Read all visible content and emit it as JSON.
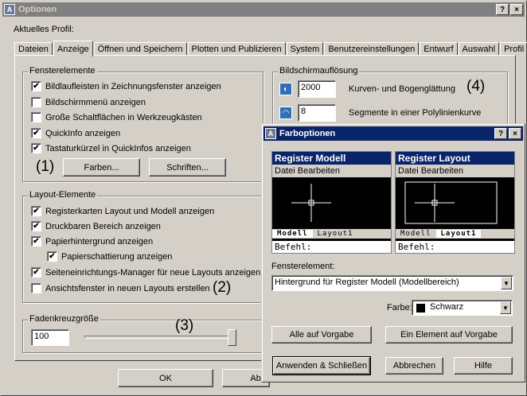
{
  "main_window": {
    "title": "Optionen",
    "help_btn": "?",
    "close_btn": "×",
    "profile_label": "Aktuelles Profil:",
    "tabs": [
      {
        "label": "Dateien"
      },
      {
        "label": "Anzeige"
      },
      {
        "label": "Öffnen und Speichern"
      },
      {
        "label": "Plotten und Publizieren"
      },
      {
        "label": "System"
      },
      {
        "label": "Benutzereinstellungen"
      },
      {
        "label": "Entwurf"
      },
      {
        "label": "Auswahl"
      },
      {
        "label": "Profil"
      }
    ],
    "selected_tab": "Anzeige"
  },
  "window_elements": {
    "legend": "Fensterelemente",
    "options": [
      {
        "label": "Bildlaufleisten in Zeichnungsfenster anzeigen",
        "checked": true
      },
      {
        "label": "Bildschirmmenü anzeigen",
        "checked": false
      },
      {
        "label": "Große Schaltflächen in Werkzeugkästen",
        "checked": false
      },
      {
        "label": "QuickInfo anzeigen",
        "checked": true
      },
      {
        "label": "Tastaturkürzel in QuickInfos anzeigen",
        "checked": true
      }
    ],
    "colors_button": "Farben...",
    "fonts_button": "Schriften...",
    "annotation": "(1)"
  },
  "layout_elements": {
    "legend": "Layout-Elemente",
    "options": [
      {
        "label": "Registerkarten Layout und Modell anzeigen",
        "checked": true
      },
      {
        "label": "Druckbaren Bereich anzeigen",
        "checked": true
      },
      {
        "label": "Papierhintergrund anzeigen",
        "checked": true
      },
      {
        "label": "Papierschattierung anzeigen",
        "checked": true
      },
      {
        "label": "Seiteneinrichtungs-Manager für neue Layouts anzeigen",
        "checked": true
      },
      {
        "label": "Ansichtsfenster in neuen Layouts erstellen",
        "checked": false
      }
    ],
    "annotation": "(2)"
  },
  "crosshair": {
    "legend": "Fadenkreuzgröße",
    "value": "100",
    "slider_level": 1.0,
    "annotation": "(3)"
  },
  "resolution": {
    "legend": "Bildschirmauflösung",
    "arc_value": "2000",
    "arc_label": "Kurven- und Bogenglättung",
    "seg_value": "8",
    "seg_label": "Segmente in einer Polylinienkurve",
    "annotation": "(4)"
  },
  "main_buttons": {
    "ok": "OK",
    "cancel_partial": "Abb"
  },
  "color_dialog": {
    "title": "Farboptionen",
    "help_btn": "?",
    "close_btn": "×",
    "preview_model": {
      "title": "Register Modell",
      "menu": "Datei  Bearbeiten",
      "tab_model": "Modell",
      "tab_layout": "Layout1",
      "command": "Befehl:"
    },
    "preview_layout": {
      "title": "Register Layout",
      "menu": "Datei  Bearbeiten",
      "tab_model": "Modell",
      "tab_layout": "Layout1",
      "command": "Befehl:"
    },
    "element_label": "Fensterelement:",
    "element_value": "Hintergrund für Register Modell (Modellbereich)",
    "color_label": "Farbe:",
    "color_value": "Schwarz",
    "color_swatch": "#000000",
    "restore_all": "Alle auf Vorgabe",
    "restore_one": "Ein Element auf Vorgabe",
    "apply_close": "Anwenden & Schließen",
    "cancel": "Abbrechen",
    "help": "Hilfe"
  }
}
